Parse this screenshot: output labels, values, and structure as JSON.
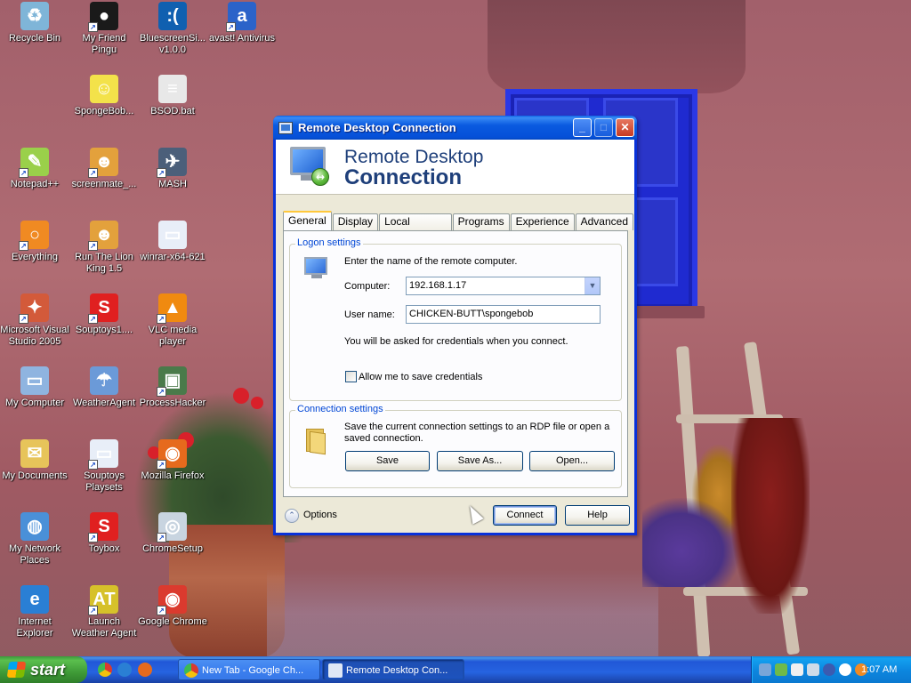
{
  "desktop_icons": [
    {
      "name": "recycle-bin-icon",
      "label": "Recycle Bin",
      "color": "#7fb5d8",
      "glyph": "♻"
    },
    {
      "name": "my-friend-pingu-icon",
      "label": "My Friend Pingu",
      "color": "#1a1a1a",
      "glyph": "●"
    },
    {
      "name": "bluescreen-icon",
      "label": "BluescreenSi... v1.0.0",
      "color": "#1060b0",
      "glyph": ":("
    },
    {
      "name": "avast-icon",
      "label": "avast! Antivirus",
      "color": "#2b63c9",
      "glyph": "a"
    },
    {
      "name": "spongebob-icon",
      "label": "SpongeBob...",
      "color": "#f3e24a",
      "glyph": "☺"
    },
    {
      "name": "bsod-bat-icon",
      "label": "BSOD.bat",
      "color": "#e8e8e8",
      "glyph": "≡"
    },
    {
      "name": "notepadpp-icon",
      "label": "Notepad++",
      "color": "#9ad04a",
      "glyph": "✎"
    },
    {
      "name": "screenmate-icon",
      "label": "screenmate_...",
      "color": "#e3a13c",
      "glyph": "☻"
    },
    {
      "name": "mash-icon",
      "label": "MASH",
      "color": "#4b5f7a",
      "glyph": "✈"
    },
    {
      "name": "everything-icon",
      "label": "Everything",
      "color": "#f08a22",
      "glyph": "○"
    },
    {
      "name": "lion-king-icon",
      "label": "Run The Lion King 1.5",
      "color": "#e3a13c",
      "glyph": "☻"
    },
    {
      "name": "winrar-icon",
      "label": "winrar-x64-621",
      "color": "#e8eef8",
      "glyph": "▭"
    },
    {
      "name": "visual-studio-icon",
      "label": "Microsoft Visual Studio 2005",
      "color": "#d35a3a",
      "glyph": "✦"
    },
    {
      "name": "souptoys-icon",
      "label": "Souptoys1....",
      "color": "#e02020",
      "glyph": "S"
    },
    {
      "name": "vlc-icon",
      "label": "VLC media player",
      "color": "#f08a10",
      "glyph": "▲"
    },
    {
      "name": "my-computer-icon",
      "label": "My Computer",
      "color": "#8fb4e0",
      "glyph": "▭"
    },
    {
      "name": "weatheragent-icon",
      "label": "WeatherAgent",
      "color": "#6b9ad8",
      "glyph": "☂"
    },
    {
      "name": "processhacker-icon",
      "label": "ProcessHacker",
      "color": "#4a7a4a",
      "glyph": "▣"
    },
    {
      "name": "my-documents-icon",
      "label": "My Documents",
      "color": "#e7c45a",
      "glyph": "✉"
    },
    {
      "name": "souptoys-playsets-icon",
      "label": "Souptoys Playsets",
      "color": "#e8eef8",
      "glyph": "▭"
    },
    {
      "name": "firefox-icon",
      "label": "Mozilla Firefox",
      "color": "#e66a1d",
      "glyph": "◉"
    },
    {
      "name": "my-network-places-icon",
      "label": "My Network Places",
      "color": "#4a90d8",
      "glyph": "◍"
    },
    {
      "name": "toybox-icon",
      "label": "Toybox",
      "color": "#e02020",
      "glyph": "S"
    },
    {
      "name": "chromesetup-icon",
      "label": "ChromeSetup",
      "color": "#c8d4e0",
      "glyph": "◎"
    },
    {
      "name": "internet-explorer-icon",
      "label": "Internet Explorer",
      "color": "#2a7fd4",
      "glyph": "e"
    },
    {
      "name": "launch-weather-agent-icon",
      "label": "Launch Weather Agent",
      "color": "#d6c12a",
      "glyph": "AT"
    },
    {
      "name": "google-chrome-icon",
      "label": "Google Chrome",
      "color": "#db3a2e",
      "glyph": "◉"
    }
  ],
  "window": {
    "title": "Remote Desktop Connection",
    "banner_line1": "Remote Desktop",
    "banner_line2": "Connection",
    "minimize_glyph": "_",
    "maximize_glyph": "□",
    "close_glyph": "✕"
  },
  "tabs": [
    "General",
    "Display",
    "Local Resources",
    "Programs",
    "Experience",
    "Advanced"
  ],
  "logon_settings": {
    "label": "Logon settings",
    "instruction": "Enter the name of the remote computer.",
    "computer_label": "Computer:",
    "computer_value": "192.168.1.17",
    "username_label": "User name:",
    "username_value": "CHICKEN-BUTT\\spongebob",
    "credentials_note": "You will be asked for credentials when you connect.",
    "allow_save_label": "Allow me to save credentials",
    "allow_save_checked": false
  },
  "connection_settings": {
    "label": "Connection settings",
    "description": "Save the current connection settings to an RDP file or open a saved connection.",
    "save_button": "Save",
    "save_as_button": "Save As...",
    "open_button": "Open..."
  },
  "footer": {
    "options_label": "Options",
    "connect_button": "Connect",
    "help_button": "Help"
  },
  "taskbar": {
    "start_label": "start",
    "tasks": [
      {
        "label": "New Tab - Google Ch...",
        "icon": "chrome-icon",
        "active": false
      },
      {
        "label": "Remote Desktop Con...",
        "icon": "rdc-icon",
        "active": true
      }
    ],
    "clock": "1:07 AM"
  },
  "colors": {
    "titlebar": "#0a5ae0",
    "group_label": "#0046d5",
    "taskbar": "#2663e0",
    "start": "#3f9b37"
  }
}
